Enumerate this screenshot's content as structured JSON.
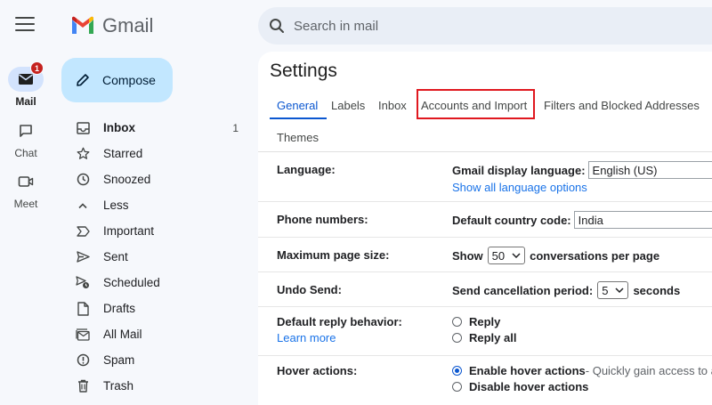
{
  "rail": {
    "items": [
      {
        "label": "Mail",
        "badge": "1",
        "icon": "mail-icon"
      },
      {
        "label": "Chat",
        "icon": "chat-icon"
      },
      {
        "label": "Meet",
        "icon": "video-icon"
      }
    ]
  },
  "logo": {
    "text": "Gmail"
  },
  "compose": {
    "label": "Compose"
  },
  "search": {
    "placeholder": "Search in mail"
  },
  "nav": {
    "items": [
      {
        "label": "Inbox",
        "count": "1",
        "icon": "inbox-icon"
      },
      {
        "label": "Starred",
        "icon": "star-icon"
      },
      {
        "label": "Snoozed",
        "icon": "clock-icon"
      },
      {
        "label": "Less",
        "icon": "chevron-up-icon"
      },
      {
        "label": "Important",
        "icon": "important-icon"
      },
      {
        "label": "Sent",
        "icon": "send-icon"
      },
      {
        "label": "Scheduled",
        "icon": "scheduled-icon"
      },
      {
        "label": "Drafts",
        "icon": "draft-icon"
      },
      {
        "label": "All Mail",
        "icon": "all-mail-icon"
      },
      {
        "label": "Spam",
        "icon": "spam-icon"
      },
      {
        "label": "Trash",
        "icon": "trash-icon"
      }
    ]
  },
  "settings": {
    "title": "Settings",
    "tabs": [
      "General",
      "Labels",
      "Inbox",
      "Accounts and Import",
      "Filters and Blocked Addresses",
      "Themes"
    ],
    "rows": {
      "language": {
        "label": "Language:",
        "field_label": "Gmail display language:",
        "value": "English (US)",
        "link": "Show all language options"
      },
      "phone": {
        "label": "Phone numbers:",
        "field_label": "Default country code:",
        "value": "India"
      },
      "page_size": {
        "label": "Maximum page size:",
        "prefix": "Show",
        "value": "50",
        "suffix": "conversations per page"
      },
      "undo": {
        "label": "Undo Send:",
        "field_label": "Send cancellation period:",
        "value": "5",
        "suffix": "seconds"
      },
      "reply": {
        "label": "Default reply behavior:",
        "link": "Learn more",
        "option1": "Reply",
        "option2": "Reply all"
      },
      "hover": {
        "label": "Hover actions:",
        "option1": "Enable hover actions",
        "option1_desc": " - Quickly gain access to a",
        "option2": "Disable hover actions"
      }
    }
  },
  "colors": {
    "accent": "#0b57d0",
    "compose_bg": "#c2e7ff",
    "highlight": "#e0181f"
  }
}
